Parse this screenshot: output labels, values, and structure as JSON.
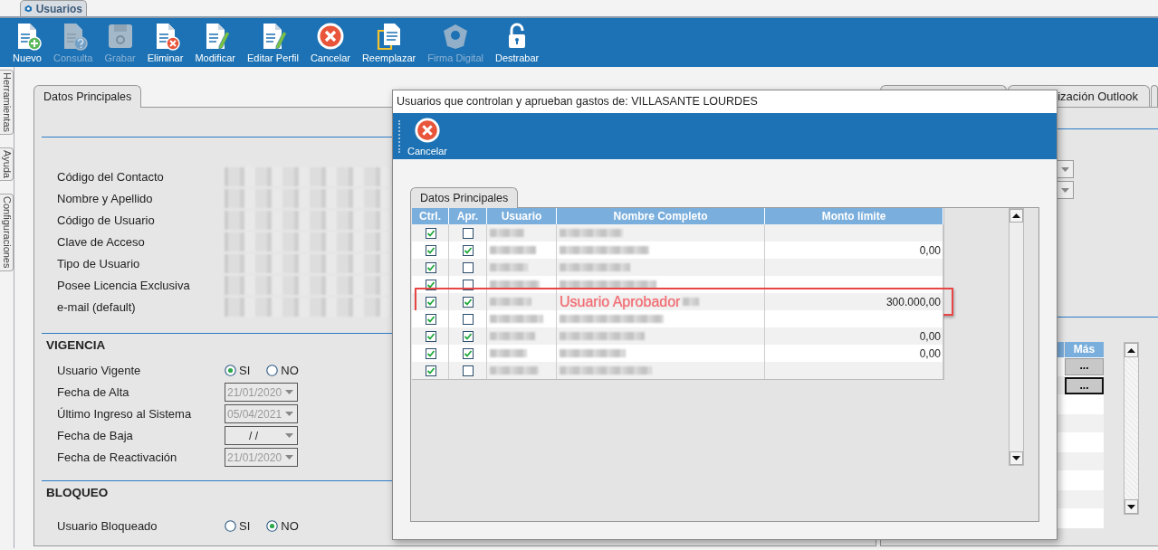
{
  "app_tab": {
    "label": "Usuarios"
  },
  "toolbar": {
    "buttons": [
      {
        "label": "Nuevo",
        "kind": "new",
        "disabled": false
      },
      {
        "label": "Consulta",
        "kind": "query",
        "disabled": true
      },
      {
        "label": "Grabar",
        "kind": "save",
        "disabled": true
      },
      {
        "label": "Eliminar",
        "kind": "delete",
        "disabled": false
      },
      {
        "label": "Modificar",
        "kind": "edit",
        "disabled": false
      },
      {
        "label": "Editar Perfil",
        "kind": "edit",
        "disabled": false
      },
      {
        "label": "Cancelar",
        "kind": "cancel",
        "disabled": false
      },
      {
        "label": "Reemplazar",
        "kind": "replace",
        "disabled": false
      },
      {
        "label": "Firma Digital",
        "kind": "sign",
        "disabled": true
      },
      {
        "label": "Destrabar",
        "kind": "unlock",
        "disabled": false
      }
    ]
  },
  "side_tabs": [
    "Herramientas",
    "Ayuda",
    "Configuraciones"
  ],
  "form": {
    "tab": "Datos Principales",
    "fields": [
      "Código del Contacto",
      "Nombre y Apellido",
      "Código de Usuario",
      "Clave de Acceso",
      "Tipo de Usuario",
      "Posee Licencia Exclusiva",
      "e-mail (default)"
    ],
    "sections": [
      {
        "title": "VIGENCIA",
        "rows": [
          {
            "kind": "radio",
            "label": "Usuario Vigente",
            "options": [
              {
                "label": "SI",
                "selected": true
              },
              {
                "label": "NO",
                "selected": false
              }
            ]
          },
          {
            "kind": "date",
            "label": "Fecha de Alta",
            "value": "21/01/2020",
            "disabled": true
          },
          {
            "kind": "date",
            "label": "Último Ingreso al Sistema",
            "value": "05/04/2021",
            "disabled": true
          },
          {
            "kind": "date",
            "label": "Fecha de Baja",
            "value": "/  /",
            "disabled": false
          },
          {
            "kind": "date",
            "label": "Fecha de Reactivación",
            "value": "21/01/2020",
            "disabled": true
          }
        ]
      },
      {
        "title": "BLOQUEO",
        "rows": [
          {
            "kind": "radio",
            "label": "Usuario Bloqueado",
            "options": [
              {
                "label": "SI",
                "selected": false
              },
              {
                "label": "NO",
                "selected": true
              }
            ]
          }
        ]
      }
    ]
  },
  "right_panel": {
    "tabs": [
      {
        "label": "ización Outlook"
      }
    ],
    "table": {
      "columns": [
        "Más"
      ],
      "rows": [
        {
          "action": "...",
          "focused": false
        },
        {
          "action": "...",
          "focused": true
        }
      ]
    }
  },
  "dialog": {
    "title": "Usuarios que controlan y aprueban gastos de: VILLASANTE LOURDES",
    "toolbar": [
      {
        "label": "Cancelar"
      }
    ],
    "tab": "Datos Principales",
    "columns": [
      "Ctrl.",
      "Apr.",
      "Usuario",
      "Nombre Completo",
      "Monto límite"
    ],
    "rows": [
      {
        "ctrl": true,
        "apr": false
      },
      {
        "ctrl": true,
        "apr": true,
        "monto": "0,00"
      },
      {
        "ctrl": true,
        "apr": false
      },
      {
        "ctrl": true,
        "apr": false
      },
      {
        "ctrl": true,
        "apr": true,
        "monto": "300.000,00",
        "highlight": true,
        "note": "Usuario Aprobador"
      },
      {
        "ctrl": true,
        "apr": false
      },
      {
        "ctrl": true,
        "apr": true,
        "monto": "0,00"
      },
      {
        "ctrl": true,
        "apr": true,
        "monto": "0,00"
      },
      {
        "ctrl": true,
        "apr": false
      }
    ]
  }
}
